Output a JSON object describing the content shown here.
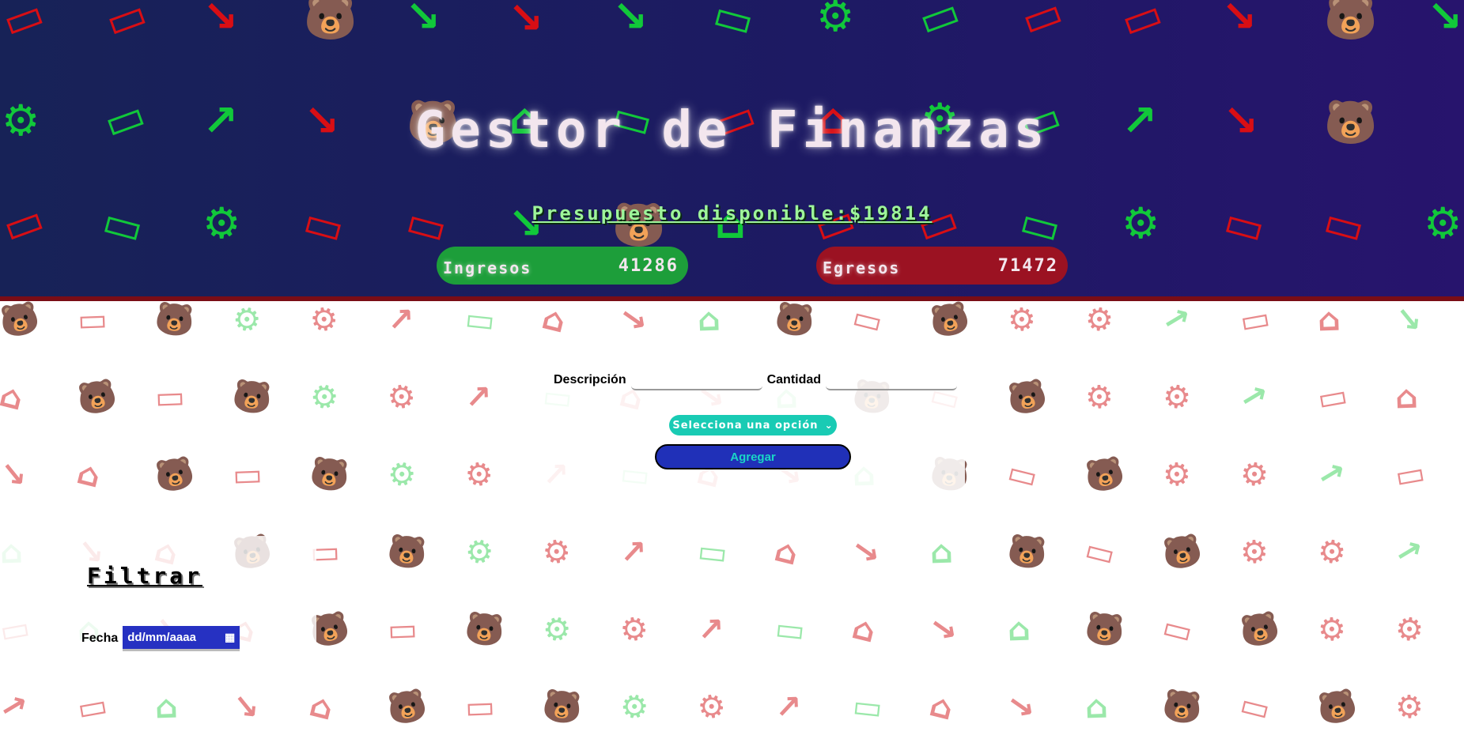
{
  "header": {
    "title": "Gestor de Finanzas",
    "budget_label": "Presupuesto disponible:",
    "budget_currency": "$",
    "budget_value": "19814"
  },
  "summary": {
    "income_label": "Ingresos",
    "income_value": "41286",
    "expense_label": "Egresos",
    "expense_value": "71472"
  },
  "form": {
    "description_label": "Descripción",
    "description_value": "",
    "amount_label": "Cantidad",
    "amount_value": "",
    "type_select_value": "Selecciona una opción",
    "add_label": "Agregar"
  },
  "filter": {
    "title": "Filtrar",
    "date_label": "Fecha",
    "date_placeholder": "dd/mm/aaaa"
  },
  "colors": {
    "income_green": "#1d9e3a",
    "expense_red": "#9b1222",
    "header_bg": "#1b1c60",
    "select_teal": "#19cbb4",
    "button_blue": "#2030b8"
  },
  "icons": {
    "arrow_up": "↗",
    "arrow_down": "↘",
    "gear": "⚙",
    "banknote": "▭",
    "bank": "⌂",
    "bear": "🐻",
    "chevron": "⌄",
    "calendar": "▦"
  }
}
